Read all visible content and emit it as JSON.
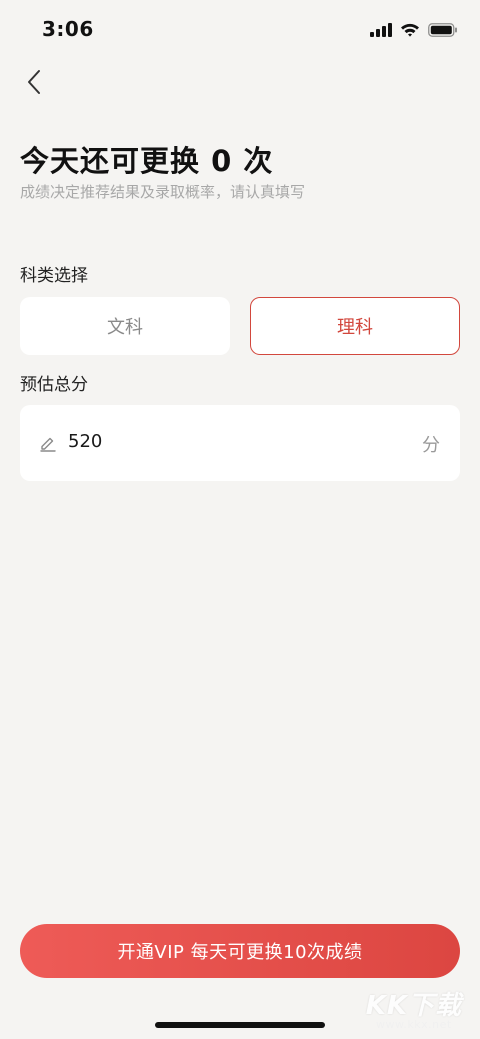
{
  "status_bar": {
    "time": "3:06",
    "icons": [
      "cellular-signal-icon",
      "wifi-icon",
      "battery-icon"
    ]
  },
  "nav": {
    "back_icon": "chevron-left-icon"
  },
  "header": {
    "title": "今天还可更换 0 次",
    "subtitle": "成绩决定推荐结果及录取概率，请认真填写"
  },
  "subject": {
    "label": "科类选择",
    "options": [
      {
        "label": "文科",
        "selected": false
      },
      {
        "label": "理科",
        "selected": true
      }
    ]
  },
  "score": {
    "label": "预估总分",
    "icon": "pencil-icon",
    "value": "520",
    "unit": "分"
  },
  "footer": {
    "vip_button_label": "开通VIP 每天可更换10次成绩"
  },
  "watermark": {
    "logo": "KK下载",
    "url": "www.kkx.net"
  },
  "colors": {
    "accent": "#d2473d",
    "background": "#f5f4f2",
    "card": "#ffffff",
    "button_gradient_start": "#ee5b57",
    "button_gradient_end": "#dc4641"
  }
}
